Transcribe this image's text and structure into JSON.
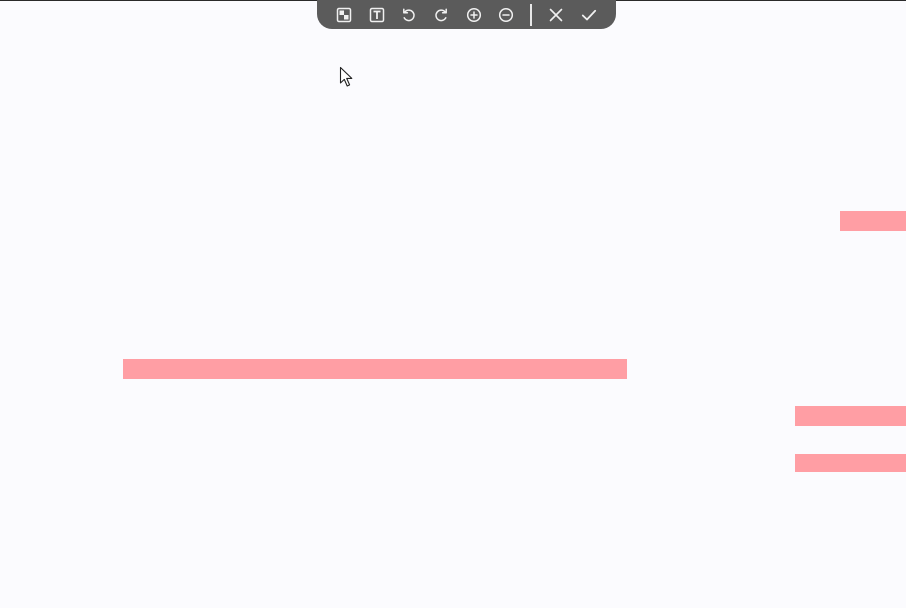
{
  "toolbar": {
    "buttons": [
      {
        "name": "area-select-button",
        "icon": "area-select-icon"
      },
      {
        "name": "text-button",
        "icon": "text-box-icon"
      },
      {
        "name": "undo-button",
        "icon": "undo-icon"
      },
      {
        "name": "redo-button",
        "icon": "redo-icon"
      },
      {
        "name": "zoom-in-button",
        "icon": "zoom-in-icon"
      },
      {
        "name": "zoom-out-button",
        "icon": "zoom-out-icon"
      },
      {
        "name": "cancel-button",
        "icon": "close-icon"
      },
      {
        "name": "confirm-button",
        "icon": "checkmark-icon"
      }
    ]
  },
  "colors": {
    "background": "#fbfbfe",
    "toolbar": "#5b5b5b",
    "icon": "#f0f0f0",
    "highlight": "#ff9ea4"
  },
  "cursor": {
    "icon": "mouse-pointer-icon"
  }
}
